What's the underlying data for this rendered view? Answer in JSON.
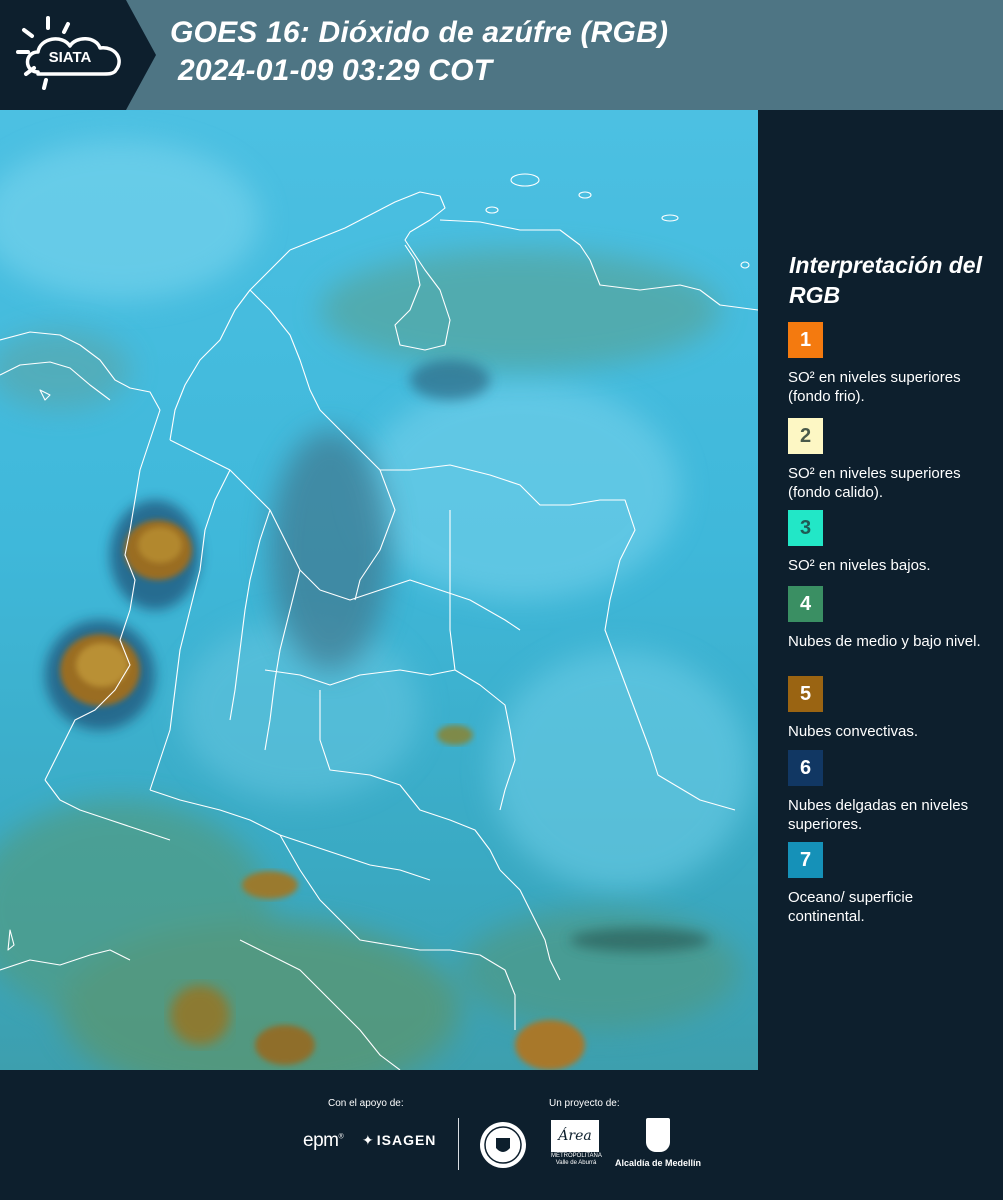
{
  "header": {
    "logo_text": "SIATA",
    "title_line1": "GOES 16: Dióxido de azúfre (RGB)",
    "title_line2": "2024-01-09 03:29 COT"
  },
  "legend": {
    "title": "Interpretación del RGB",
    "items": [
      {
        "number": "1",
        "color": "#f47a0f",
        "text_color": "#ffffff",
        "label": "SO² en niveles superiores (fondo frio)."
      },
      {
        "number": "2",
        "color": "#fdf7c4",
        "text_color": "#4a5a4a",
        "label": "SO² en niveles superiores (fondo calido)."
      },
      {
        "number": "3",
        "color": "#22e7c7",
        "text_color": "#1f5b55",
        "label": "SO² en niveles bajos."
      },
      {
        "number": "4",
        "color": "#3a8f63",
        "text_color": "#ffffff",
        "label": "Nubes de medio y bajo nivel."
      },
      {
        "number": "5",
        "color": "#9a6412",
        "text_color": "#ffffff",
        "label": "Nubes convectivas."
      },
      {
        "number": "6",
        "color": "#113763",
        "text_color": "#ffffff",
        "label": "Nubes delgadas en niveles superiores."
      },
      {
        "number": "7",
        "color": "#1591b8",
        "text_color": "#ffffff",
        "label": "Oceano/ superficie continental."
      }
    ]
  },
  "footer": {
    "support_label": "Con el apoyo de:",
    "project_label": "Un proyecto de:",
    "epm": "epm",
    "isagen": "ISAGEN",
    "area_logo_text": "Área",
    "area_caption": "METROPOLITANA Valle de Aburrá",
    "alcaldia": "Alcaldía de Medellín"
  },
  "colors": {
    "header_bg": "#4e7584",
    "panel_bg": "#0d1f2d",
    "map_base": "#3fb8da"
  }
}
